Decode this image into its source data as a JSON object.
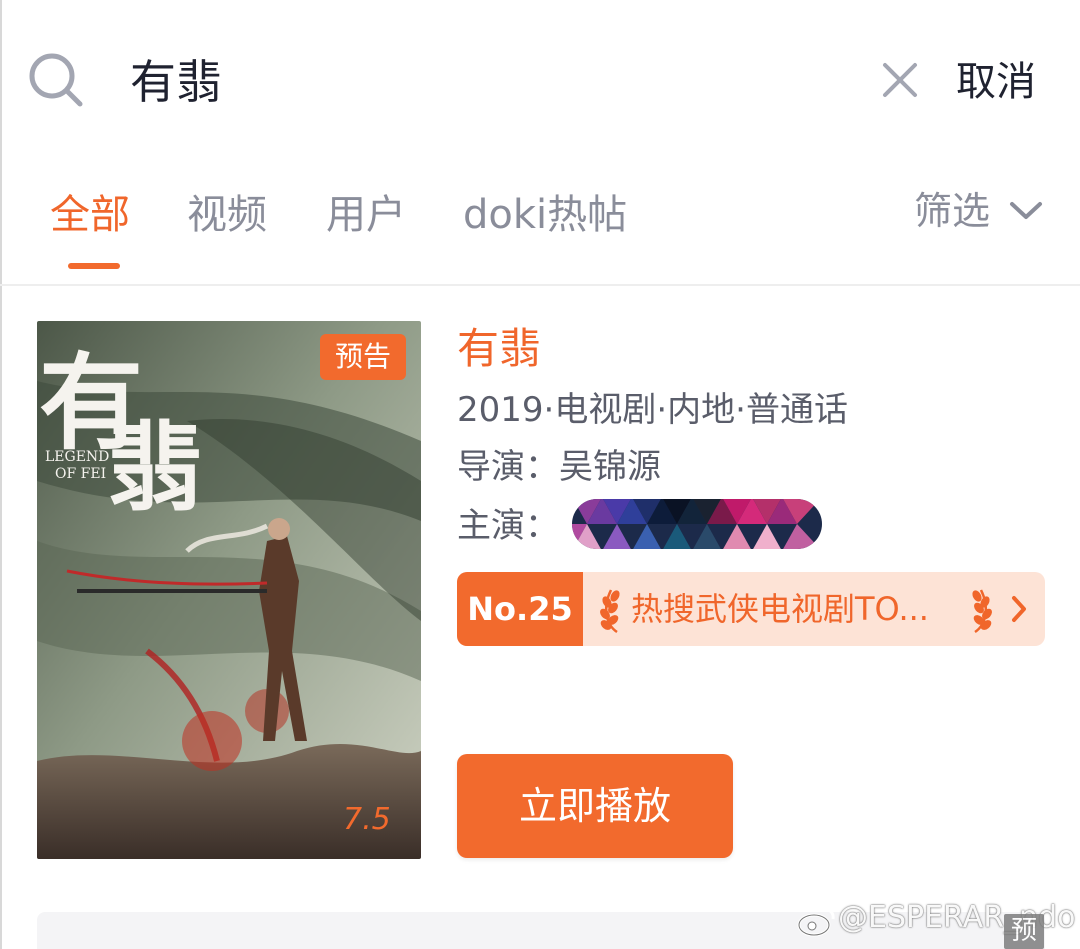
{
  "search": {
    "query": "有翡",
    "cancel_label": "取消"
  },
  "tabs": [
    {
      "label": "全部",
      "active": true
    },
    {
      "label": "视频",
      "active": false
    },
    {
      "label": "用户",
      "active": false
    },
    {
      "label": "doki热帖",
      "active": false
    }
  ],
  "filter_label": "筛选",
  "result": {
    "poster": {
      "badge": "预告",
      "rating": "7.5",
      "title_art": "有翡",
      "subtitle_art": "LEGEND OF FEI"
    },
    "title": "有翡",
    "meta": "2019·电视剧·内地·普通话",
    "director_line": "导演：吴锦源",
    "cast_label": "主演：",
    "rank": {
      "number": "No.25",
      "text": "热搜武侠电视剧TO..."
    },
    "play_label": "立即播放"
  },
  "watermark": {
    "text": "@ESPERAR_ndo",
    "box_text": "预"
  },
  "colors": {
    "accent": "#f26a2d",
    "rank_bg": "#fde3d6",
    "muted_text": "#8a8d9a"
  }
}
